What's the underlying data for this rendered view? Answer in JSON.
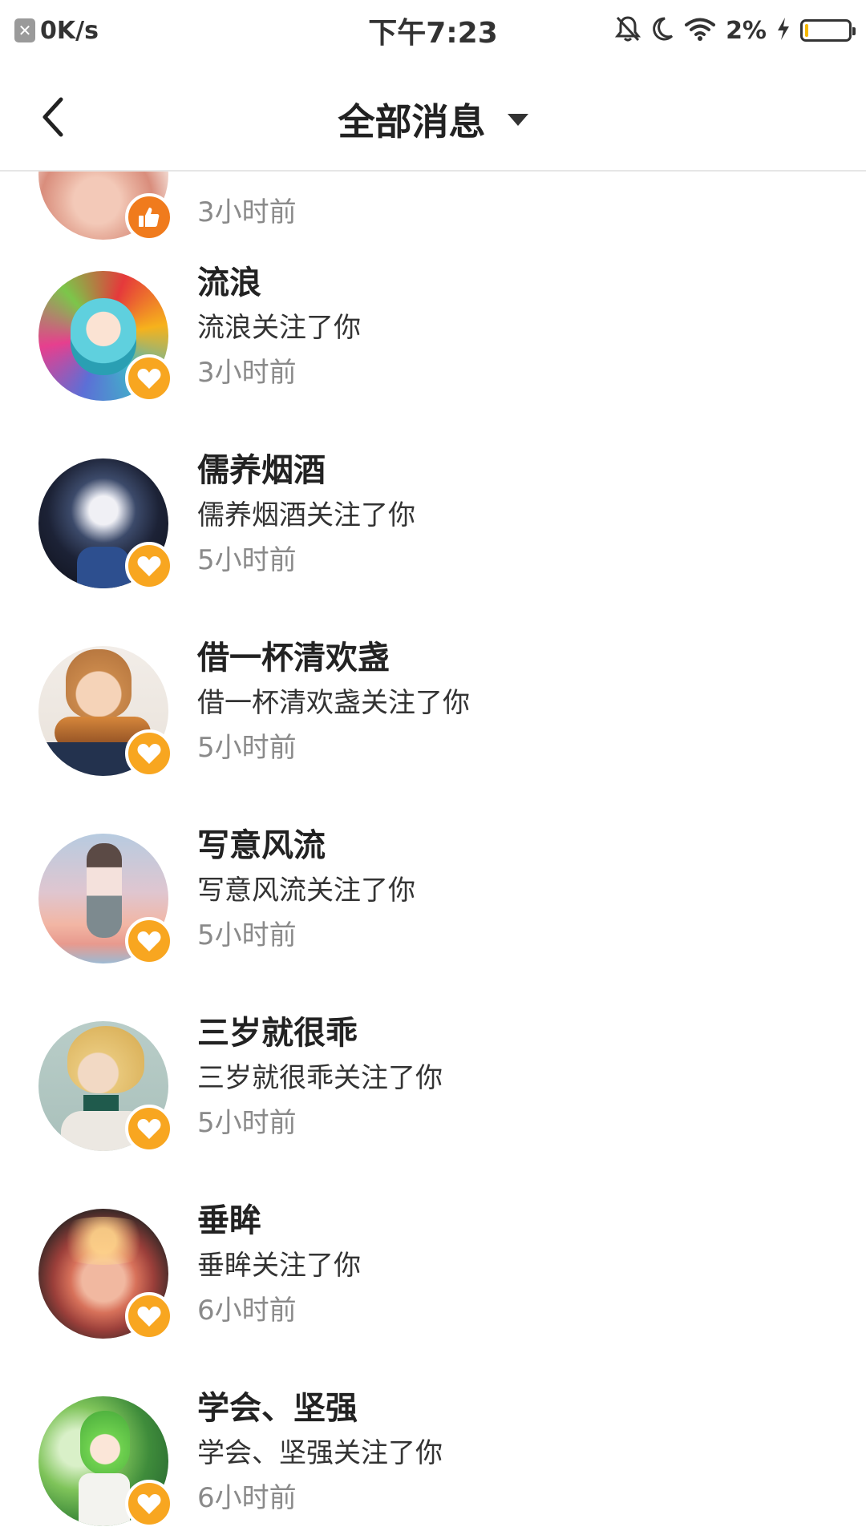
{
  "status_bar": {
    "net_speed": "0K/s",
    "time": "下午7:23",
    "battery_percent": "2%",
    "battery_level": 0.02
  },
  "header": {
    "title": "全部消息"
  },
  "colors": {
    "like_badge": "#f07b1d",
    "follow_badge": "#f8a620"
  },
  "messages": [
    {
      "name": "",
      "text": "",
      "time": "3小时前",
      "badge": "thumbs-up-icon"
    },
    {
      "name": "流浪",
      "text": "流浪关注了你",
      "time": "3小时前",
      "badge": "heart-icon"
    },
    {
      "name": "儒养烟酒",
      "text": "儒养烟酒关注了你",
      "time": "5小时前",
      "badge": "heart-icon"
    },
    {
      "name": "借一杯清欢盏",
      "text": "借一杯清欢盏关注了你",
      "time": "5小时前",
      "badge": "heart-icon"
    },
    {
      "name": "写意风流",
      "text": "写意风流关注了你",
      "time": "5小时前",
      "badge": "heart-icon"
    },
    {
      "name": "三岁就很乖",
      "text": "三岁就很乖关注了你",
      "time": "5小时前",
      "badge": "heart-icon"
    },
    {
      "name": "垂眸",
      "text": "垂眸关注了你",
      "time": "6小时前",
      "badge": "heart-icon"
    },
    {
      "name": "学会、坚强",
      "text": "学会、坚强关注了你",
      "time": "6小时前",
      "badge": "heart-icon"
    }
  ]
}
